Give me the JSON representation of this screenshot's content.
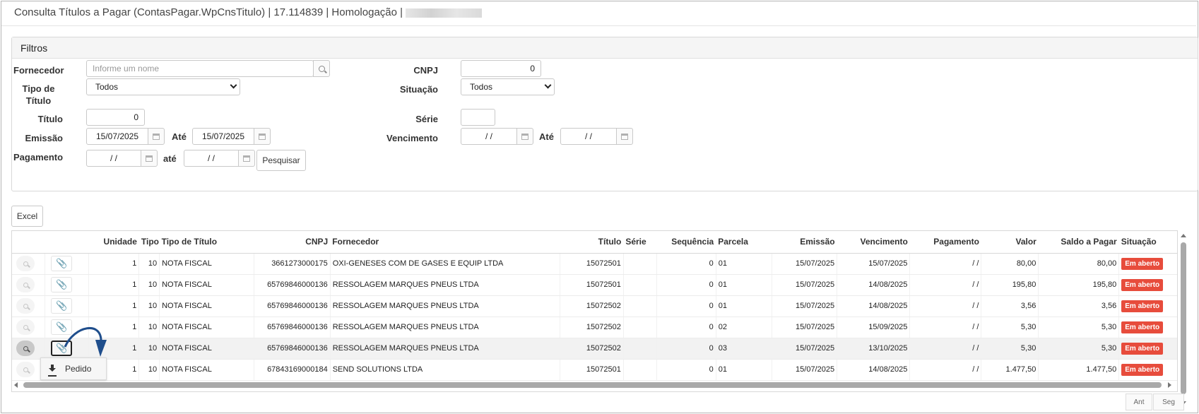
{
  "window": {
    "title": "Consulta Títulos a Pagar (ContasPagar.WpCnsTitulo) | 17.114839 | Homologação |"
  },
  "filters": {
    "heading": "Filtros",
    "fornecedor": {
      "label": "Fornecedor",
      "placeholder": "Informe um nome"
    },
    "cnpj": {
      "label": "CNPJ",
      "value": "0"
    },
    "tipo_titulo": {
      "label": "Tipo de Título",
      "value": "Todos"
    },
    "situacao": {
      "label": "Situação",
      "value": "Todos"
    },
    "titulo": {
      "label": "Título",
      "value": "0"
    },
    "serie": {
      "label": "Série",
      "value": ""
    },
    "emissao": {
      "label": "Emissão",
      "from": "15/07/2025",
      "to_label": "Até",
      "to": "15/07/2025"
    },
    "vencimento": {
      "label": "Vencimento",
      "from": "/ /",
      "to_label": "Até",
      "to": "/ /"
    },
    "pagamento": {
      "label": "Pagamento",
      "from": "/ /",
      "to_label": "até",
      "to": "/ /"
    },
    "search_button": "Pesquisar"
  },
  "toolbar": {
    "excel_button": "Excel"
  },
  "grid": {
    "columns": [
      "Unidade",
      "Tipo",
      "Tipo de Título",
      "CNPJ",
      "Fornecedor",
      "Título",
      "Série",
      "Sequência",
      "Parcela",
      "Emissão",
      "Vencimento",
      "Pagamento",
      "Valor",
      "Saldo a Pagar",
      "Situação"
    ],
    "rows": [
      {
        "unidade": "1",
        "tipo": "10",
        "tipo_titulo": "NOTA FISCAL",
        "cnpj": "3661273000175",
        "fornecedor": "OXI-GENESES COM DE GASES E EQUIP LTDA",
        "titulo": "15072501",
        "serie": "",
        "sequencia": "0",
        "parcela": "01",
        "emissao": "15/07/2025",
        "vencimento": "15/07/2025",
        "pagamento": "/ /",
        "valor": "80,00",
        "saldo": "80,00",
        "situacao": "Em aberto"
      },
      {
        "unidade": "1",
        "tipo": "10",
        "tipo_titulo": "NOTA FISCAL",
        "cnpj": "65769846000136",
        "fornecedor": "RESSOLAGEM MARQUES PNEUS LTDA",
        "titulo": "15072501",
        "serie": "",
        "sequencia": "0",
        "parcela": "01",
        "emissao": "15/07/2025",
        "vencimento": "14/08/2025",
        "pagamento": "/ /",
        "valor": "195,80",
        "saldo": "195,80",
        "situacao": "Em aberto"
      },
      {
        "unidade": "1",
        "tipo": "10",
        "tipo_titulo": "NOTA FISCAL",
        "cnpj": "65769846000136",
        "fornecedor": "RESSOLAGEM MARQUES PNEUS LTDA",
        "titulo": "15072502",
        "serie": "",
        "sequencia": "0",
        "parcela": "01",
        "emissao": "15/07/2025",
        "vencimento": "14/08/2025",
        "pagamento": "/ /",
        "valor": "3,56",
        "saldo": "3,56",
        "situacao": "Em aberto"
      },
      {
        "unidade": "1",
        "tipo": "10",
        "tipo_titulo": "NOTA FISCAL",
        "cnpj": "65769846000136",
        "fornecedor": "RESSOLAGEM MARQUES PNEUS LTDA",
        "titulo": "15072502",
        "serie": "",
        "sequencia": "0",
        "parcela": "02",
        "emissao": "15/07/2025",
        "vencimento": "15/09/2025",
        "pagamento": "/ /",
        "valor": "5,30",
        "saldo": "5,30",
        "situacao": "Em aberto"
      },
      {
        "unidade": "1",
        "tipo": "10",
        "tipo_titulo": "NOTA FISCAL",
        "cnpj": "65769846000136",
        "fornecedor": "RESSOLAGEM MARQUES PNEUS LTDA",
        "titulo": "15072502",
        "serie": "",
        "sequencia": "0",
        "parcela": "03",
        "emissao": "15/07/2025",
        "vencimento": "13/10/2025",
        "pagamento": "/ /",
        "valor": "5,30",
        "saldo": "5,30",
        "situacao": "Em aberto"
      },
      {
        "unidade": "1",
        "tipo": "10",
        "tipo_titulo": "NOTA FISCAL",
        "cnpj": "67843169000184",
        "fornecedor": "SEND SOLUTIONS LTDA",
        "titulo": "15072501",
        "serie": "",
        "sequencia": "0",
        "parcela": "01",
        "emissao": "15/07/2025",
        "vencimento": "14/08/2025",
        "pagamento": "/ /",
        "valor": "1.477,50",
        "saldo": "1.477,50",
        "situacao": "Em aberto"
      }
    ]
  },
  "popup": {
    "item_label": "Pedido",
    "icon": "download-icon"
  },
  "pager": {
    "prev": "Ant",
    "next": "Seg"
  },
  "colors": {
    "status_open": "#e74c3c",
    "arrow": "#1f4e8c"
  }
}
